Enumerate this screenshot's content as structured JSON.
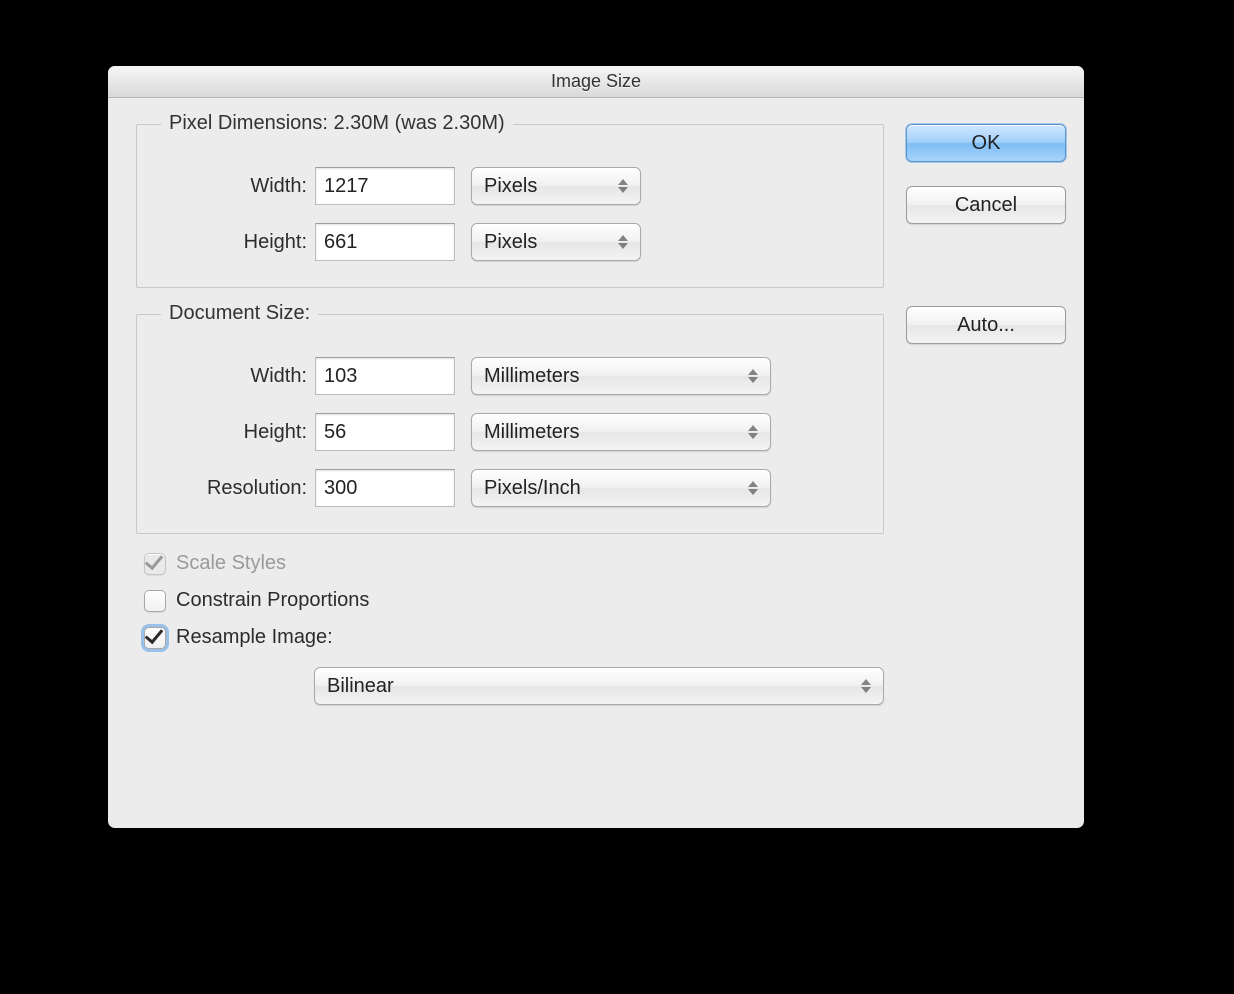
{
  "window": {
    "title": "Image Size"
  },
  "pixel_dimensions": {
    "legend": "Pixel Dimensions:  2.30M (was 2.30M)",
    "width_label": "Width:",
    "width_value": "1217",
    "width_unit": "Pixels",
    "height_label": "Height:",
    "height_value": "661",
    "height_unit": "Pixels"
  },
  "document_size": {
    "legend": "Document Size:",
    "width_label": "Width:",
    "width_value": "103",
    "width_unit": "Millimeters",
    "height_label": "Height:",
    "height_value": "56",
    "height_unit": "Millimeters",
    "resolution_label": "Resolution:",
    "resolution_value": "300",
    "resolution_unit": "Pixels/Inch"
  },
  "options": {
    "scale_styles": "Scale Styles",
    "constrain_proportions": "Constrain Proportions",
    "resample_image": "Resample Image:",
    "resample_method": "Bilinear"
  },
  "buttons": {
    "ok": "OK",
    "cancel": "Cancel",
    "auto": "Auto..."
  }
}
